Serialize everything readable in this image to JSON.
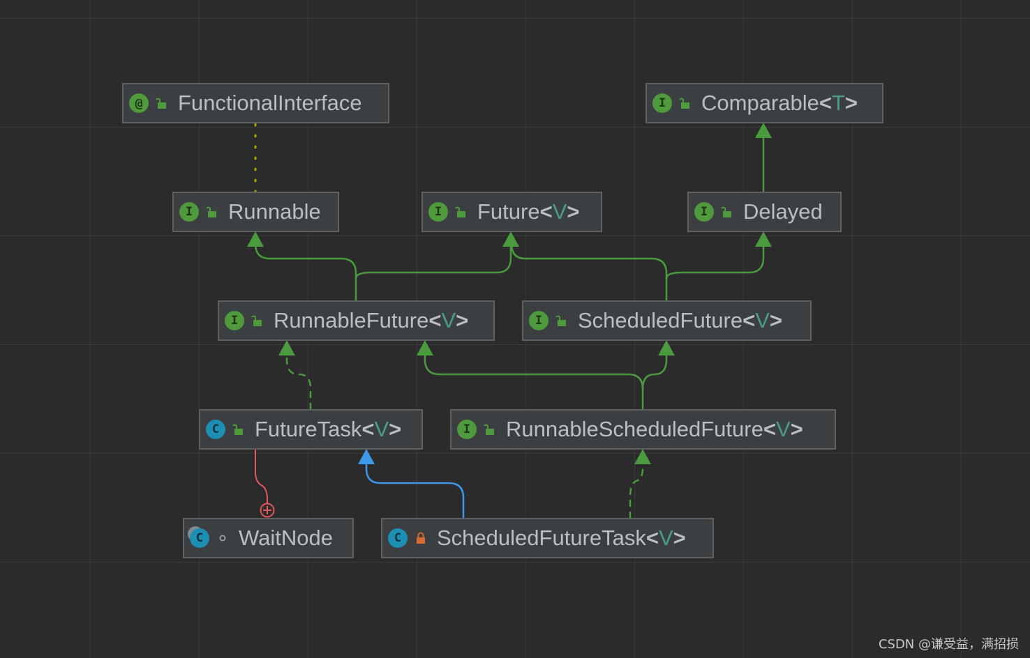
{
  "nodes": {
    "functional_interface": {
      "kind": "@",
      "name": "FunctionalInterface",
      "type_param": ""
    },
    "comparable": {
      "kind": "I",
      "name": "Comparable",
      "type_param": "T"
    },
    "runnable": {
      "kind": "I",
      "name": "Runnable",
      "type_param": ""
    },
    "future": {
      "kind": "I",
      "name": "Future",
      "type_param": "V"
    },
    "delayed": {
      "kind": "I",
      "name": "Delayed",
      "type_param": ""
    },
    "runnable_future": {
      "kind": "I",
      "name": "RunnableFuture",
      "type_param": "V"
    },
    "scheduled_future": {
      "kind": "I",
      "name": "ScheduledFuture",
      "type_param": "V"
    },
    "future_task": {
      "kind": "C",
      "name": "FutureTask",
      "type_param": "V"
    },
    "runnable_scheduled_future": {
      "kind": "I",
      "name": "RunnableScheduledFuture",
      "type_param": "V"
    },
    "wait_node": {
      "kind": "C",
      "name": "WaitNode",
      "type_param": ""
    },
    "scheduled_future_task": {
      "kind": "C",
      "name": "ScheduledFutureTask",
      "type_param": "V"
    }
  },
  "edges": [
    {
      "from": "runnable",
      "to": "functional_interface",
      "kind": "annotated"
    },
    {
      "from": "delayed",
      "to": "comparable",
      "kind": "extends"
    },
    {
      "from": "runnable_future",
      "to": "runnable",
      "kind": "extends"
    },
    {
      "from": "runnable_future",
      "to": "future",
      "kind": "extends"
    },
    {
      "from": "scheduled_future",
      "to": "future",
      "kind": "extends"
    },
    {
      "from": "scheduled_future",
      "to": "delayed",
      "kind": "extends"
    },
    {
      "from": "future_task",
      "to": "runnable_future",
      "kind": "implements"
    },
    {
      "from": "runnable_scheduled_future",
      "to": "runnable_future",
      "kind": "extends"
    },
    {
      "from": "runnable_scheduled_future",
      "to": "scheduled_future",
      "kind": "extends"
    },
    {
      "from": "scheduled_future_task",
      "to": "future_task",
      "kind": "class-extends"
    },
    {
      "from": "scheduled_future_task",
      "to": "runnable_scheduled_future",
      "kind": "implements"
    },
    {
      "from": "wait_node",
      "to": "future_task",
      "kind": "inner-class"
    }
  ],
  "colors": {
    "background": "#2b2b2c",
    "grid": "#3b3b3d",
    "node_fill": "#3c3f41",
    "node_border": "#5e6062",
    "interface_icon": "#4e9a3d",
    "class_icon": "#1d8fb3",
    "extends_edge": "#4a9a3e",
    "class_extends_edge": "#3d98e8",
    "inner_class_edge": "#e5575d",
    "annotation_edge": "#a9a400",
    "type_param": "#4a9b8c",
    "private_lock": "#d66a2f"
  },
  "icons": {
    "interface": "interface-icon",
    "class": "class-icon",
    "annotation": "annotation-icon",
    "public": "open-lock-icon",
    "private": "closed-lock-icon",
    "package_private": "dot-icon",
    "inner_class_connector": "circle-plus-icon"
  },
  "watermark": "CSDN @谦受益，满招损"
}
